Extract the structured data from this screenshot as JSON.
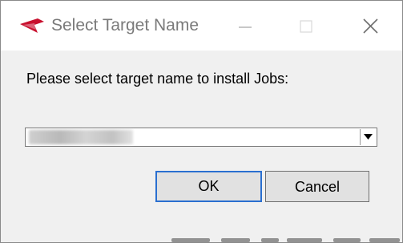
{
  "window": {
    "title": "Select Target Name",
    "app_icon": "brand-logo-icon",
    "controls": {
      "minimize_icon": "minimize-icon",
      "maximize_icon": "maximize-icon",
      "close_icon": "close-icon"
    }
  },
  "dialog": {
    "prompt": "Please select target name to install Jobs:",
    "target_select": {
      "selected_value": "",
      "dropdown_icon": "dropdown-arrow-icon"
    },
    "buttons": {
      "ok_label": "OK",
      "cancel_label": "Cancel"
    }
  },
  "colors": {
    "brand": "#c8102e",
    "focus_border": "#2a6fd0",
    "dialog_bg": "#f0f0f0",
    "title_text": "#7a7a7a"
  }
}
